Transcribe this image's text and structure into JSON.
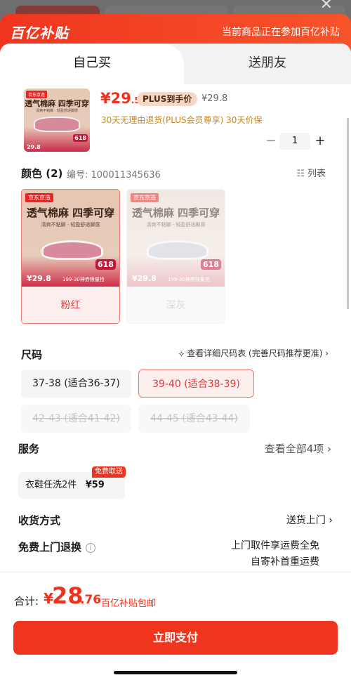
{
  "banner": {
    "logo": "百亿补贴",
    "note": "当前商品正在参加百亿补贴"
  },
  "tabs": [
    "自己买",
    "送朋友"
  ],
  "product": {
    "thumb_tag": "京东京造",
    "thumb_headline": "透气棉麻 四季可穿",
    "thumb_sub": "清爽不粘脚 · 轻盈舒适脚感",
    "thumb_price": "29.8",
    "thumb_618": "618",
    "price_int": "¥29",
    "price_dec": ".5",
    "plus_label": "PLUS到手价",
    "original_price": "¥29.8",
    "services": "30天无理由退货(PLUS会员尊享)  30天价保",
    "quantity": "1",
    "minus": "−",
    "plus": "+"
  },
  "color": {
    "title": "颜色 (2)",
    "code_label": "编号: 100011345636",
    "list_icon": "☷",
    "list_label": "列表",
    "options": [
      {
        "tag": "京东京造",
        "headline": "透气棉麻 四季可穿",
        "sub": "清爽不粘脚 · 轻盈舒适脚感",
        "badge": "618",
        "price": "¥29.8",
        "promo": "199-30神券限量抢",
        "label": "粉红",
        "state": "selected"
      },
      {
        "tag": "京东京造",
        "headline": "透气棉麻 四季可穿",
        "sub": "清爽不粘脚 · 轻盈舒适脚感",
        "badge": "618",
        "price": "¥29.8",
        "promo": "199-30神券限量抢",
        "label": "深灰",
        "state": "disabled"
      }
    ]
  },
  "size": {
    "title": "尺码",
    "chart_link": "⟡ 查看详细尺码表 (完善尺码推荐更准)  ›",
    "options": [
      {
        "label": "37-38 (适合36-37)",
        "state": "normal"
      },
      {
        "label": "39-40 (适合38-39)",
        "state": "selected"
      },
      {
        "label": "42-43 (适合41-42)",
        "state": "disabled"
      },
      {
        "label": "44-45 (适合43-44)",
        "state": "disabled"
      }
    ]
  },
  "service": {
    "title": "服务",
    "view_all": "查看全部4项 ›",
    "card_name": "衣鞋任洗2件",
    "card_price": "¥59",
    "badge": "免费取送"
  },
  "delivery": {
    "title": "收货方式",
    "value": "送货上门 ›"
  },
  "return": {
    "title": "免费上门退换",
    "info_icon": "i",
    "line1": "上门取件享运费全免",
    "line2": "自寄补首重运费"
  },
  "footer": {
    "total_label": "合计:",
    "currency": "¥",
    "total_int": "28",
    "total_dec": ".76",
    "total_note": "百亿补贴包邮",
    "pay_label": "立即支付"
  },
  "colors": {
    "brand_red": "#f0331f",
    "selected_red": "#e4393c",
    "plus_gold": "#c8861a"
  }
}
